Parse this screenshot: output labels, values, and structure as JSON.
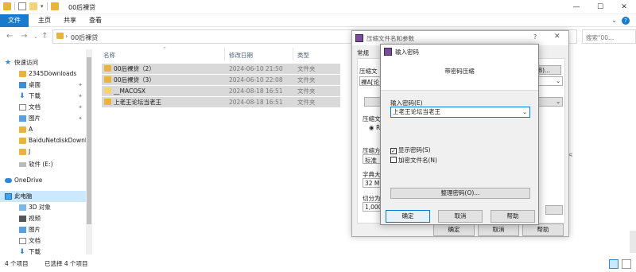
{
  "window": {
    "title": "00后裸贷",
    "min": "—",
    "max": "☐",
    "close": "✕"
  },
  "ribbon": {
    "tabs": [
      "文件",
      "主页",
      "共享",
      "查看"
    ],
    "help": "?"
  },
  "address": {
    "crumb": "00后裸贷",
    "arrow": "›",
    "search_placeholder": "搜索\"00..."
  },
  "sidebar": {
    "items": [
      {
        "label": "快速访问",
        "icon": "star-icon",
        "pin": ""
      },
      {
        "label": "2345Downloads",
        "icon": "folder-icon",
        "pin": "📌"
      },
      {
        "label": "桌面",
        "icon": "desktop-icon",
        "pin": "📌"
      },
      {
        "label": "下载",
        "icon": "download-icon",
        "pin": "📌"
      },
      {
        "label": "文档",
        "icon": "document-icon",
        "pin": "📌"
      },
      {
        "label": "图片",
        "icon": "picture-icon",
        "pin": "📌"
      },
      {
        "label": "A",
        "icon": "folder-icon",
        "pin": ""
      },
      {
        "label": "BaiduNetdiskDownlo",
        "icon": "folder-icon",
        "pin": ""
      },
      {
        "label": "J",
        "icon": "folder-icon",
        "pin": ""
      },
      {
        "label": "软件 (E:)",
        "icon": "drive-icon",
        "pin": ""
      },
      {
        "label": "OneDrive",
        "icon": "cloud-icon",
        "pin": ""
      },
      {
        "label": "此电脑",
        "icon": "computer-icon",
        "pin": ""
      },
      {
        "label": "3D 对象",
        "icon": "cube-icon",
        "pin": ""
      },
      {
        "label": "视频",
        "icon": "video-icon",
        "pin": ""
      },
      {
        "label": "图片",
        "icon": "picture-icon",
        "pin": ""
      },
      {
        "label": "文档",
        "icon": "document-icon",
        "pin": ""
      },
      {
        "label": "下载",
        "icon": "download-icon",
        "pin": ""
      }
    ]
  },
  "filelist": {
    "columns": [
      "名称",
      "修改日期",
      "类型"
    ],
    "rows": [
      {
        "name": "00后裸贷（2）",
        "date": "2024-06-10 21:50",
        "type": "文件夹"
      },
      {
        "name": "00后裸贷（3）",
        "date": "2024-06-10 22:08",
        "type": "文件夹"
      },
      {
        "name": "__MACOSX",
        "date": "2024-08-18 16:51",
        "type": "文件夹"
      },
      {
        "name": "上老王论坛当老王",
        "date": "2024-08-18 16:51",
        "type": "文件夹"
      }
    ]
  },
  "status": {
    "count": "4 个项目",
    "selected": "已选择 4 个项目"
  },
  "rar_dialog": {
    "title": "压缩文件名和参数",
    "help": "?",
    "close": "✕",
    "tab_general": "常规",
    "frag_name_label": "压缩文",
    "frag_name_value": "裸A[论",
    "frag_browse": "B)...",
    "frag_format_label": "压缩文",
    "frag_format_option": "RA",
    "frag_method_label": "压缩方",
    "frag_method_value": "标准",
    "frag_dict_label": "字典大",
    "frag_dict_value": "32 MB",
    "frag_split_label": "切分为",
    "frag_split_value": "1,000",
    "ok": "确定",
    "cancel": "取消",
    "helpbtn": "帮助"
  },
  "pw_dialog": {
    "title": "输入密码",
    "header": "带密码压缩",
    "input_label": "输入密码(E)",
    "password_value": "上老王论坛当老王",
    "show_password": "显示密码(S)",
    "encrypt_names": "加密文件名(N)",
    "organize": "整理密码(O)...",
    "ok": "确定",
    "cancel": "取消",
    "help": "帮助"
  }
}
